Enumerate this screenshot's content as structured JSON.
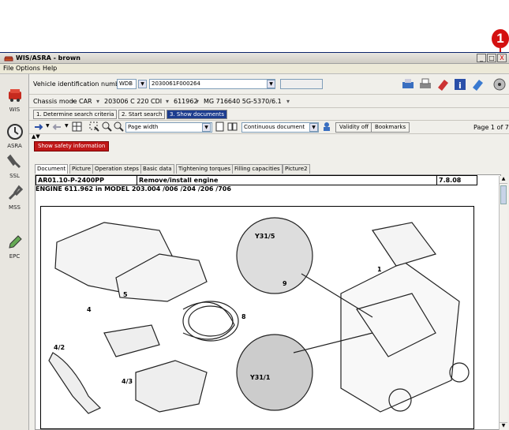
{
  "callout": {
    "number": "1",
    "color": "#d41010"
  },
  "window": {
    "title": "WIS/ASRA - brown",
    "min": "_",
    "max": "□",
    "close": "X"
  },
  "menu": [
    "File",
    "Options",
    "Help"
  ],
  "sidebar": [
    {
      "label": "WIS",
      "icon": "car-icon"
    },
    {
      "label": "ASRA",
      "icon": "clock-icon"
    },
    {
      "label": "SSL",
      "icon": "wrench-icon"
    },
    {
      "label": "MSS",
      "icon": "wrench-icon"
    },
    {
      "label": "EPC",
      "icon": "pen-icon"
    }
  ],
  "vin": {
    "label": "Vehicle identification number",
    "prefix": "WDB",
    "value": "2030061F000264"
  },
  "chassis": {
    "items": [
      "Chassis mode",
      "CAR",
      "203006 C 220 CDI",
      "611962",
      "MG 716640 5G-5370/6.1"
    ]
  },
  "steps": [
    "1. Determine search criteria",
    "2. Start search",
    "3. Show documents"
  ],
  "toolbar": {
    "zoom": "Page width",
    "mode": "Continuous document",
    "validity": "Validity off",
    "bookmarks": "Bookmarks",
    "page": "Page 1 of 7"
  },
  "safety": "Show safety information",
  "doctabs": [
    "Document",
    "Picture",
    "Operation steps",
    "Basic data",
    "Tightening torques",
    "Filling capacities",
    "Picture2"
  ],
  "doc": {
    "code": "AR01.10-P-2400PP",
    "title": "Remove/install engine",
    "date": "7.8.08",
    "engine": "ENGINE   611.962 in MODEL 203.004 /006 /204 /206 /706"
  },
  "figure": {
    "labels": [
      "1",
      "4",
      "5",
      "4/2",
      "4/3",
      "8",
      "9",
      "Y31/5",
      "Y31/1"
    ]
  }
}
